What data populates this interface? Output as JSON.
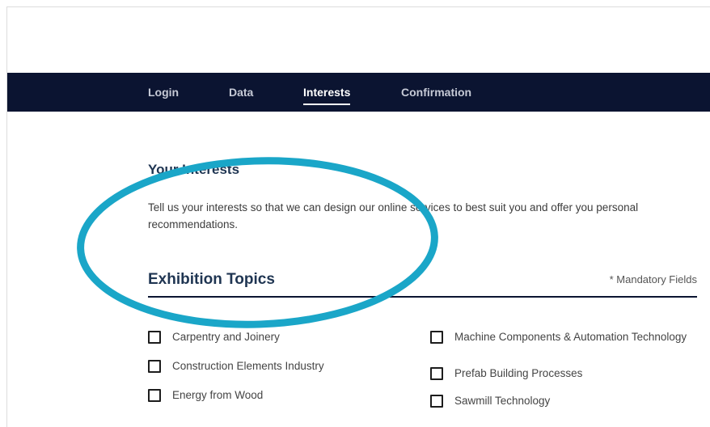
{
  "nav": {
    "tabs": [
      {
        "label": "Login",
        "active": false
      },
      {
        "label": "Data",
        "active": false
      },
      {
        "label": "Interests",
        "active": true
      },
      {
        "label": "Confirmation",
        "active": false
      }
    ]
  },
  "interests": {
    "title": "Your Interests",
    "description": "Tell us your interests so that we can design our online services to best suit you and offer you personal recommendations."
  },
  "topics": {
    "title": "Exhibition Topics",
    "mandatory_note": "* Mandatory Fields",
    "left_column": [
      {
        "label": "Carpentry and Joinery",
        "checked": false
      },
      {
        "label": "Construction Elements Industry",
        "checked": false
      },
      {
        "label": "Energy from Wood",
        "checked": false
      }
    ],
    "right_column": [
      {
        "label": "Machine Components & Automation Technology",
        "checked": false
      },
      {
        "label": "Prefab Building Processes",
        "checked": false
      },
      {
        "label": "Sawmill Technology",
        "checked": false
      }
    ]
  },
  "colors": {
    "nav_background": "#0b1431",
    "heading": "#1f3552",
    "highlight_ring": "#1aa6c8"
  }
}
